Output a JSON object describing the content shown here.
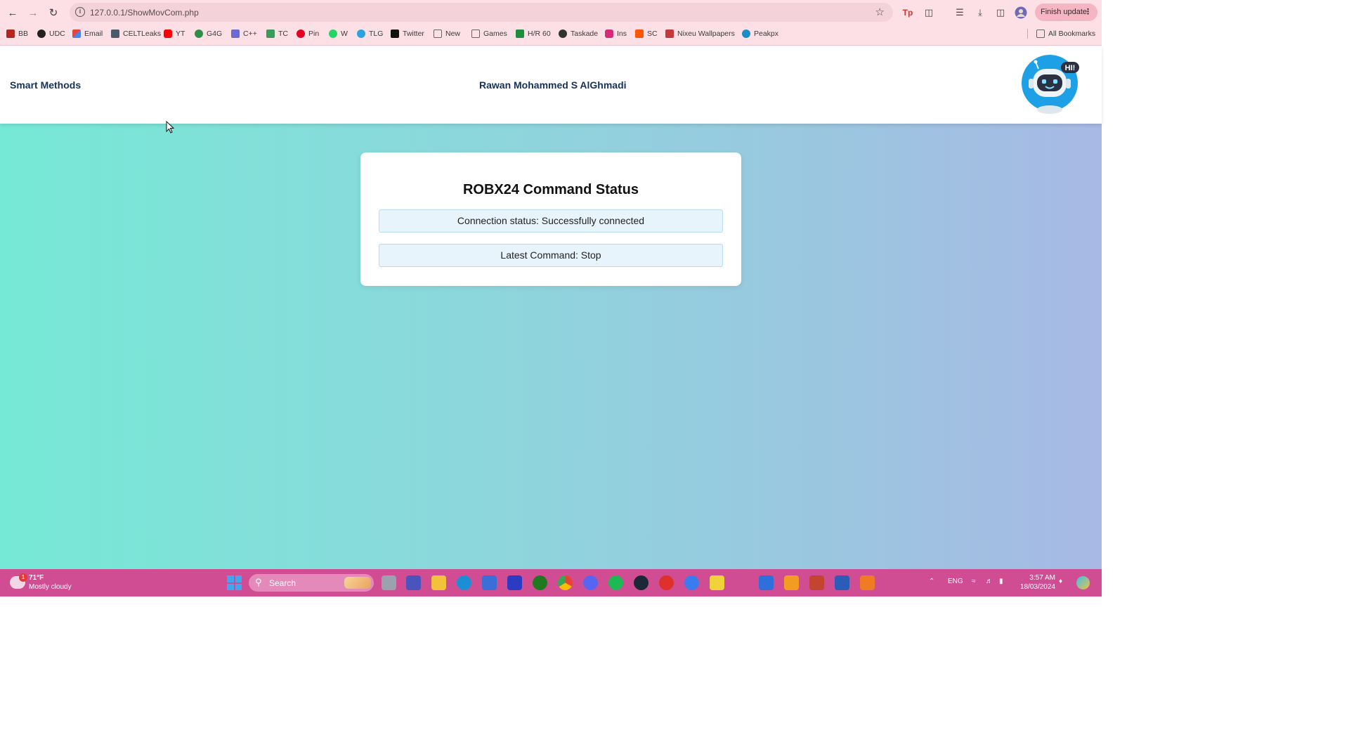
{
  "browser": {
    "url": "127.0.0.1/ShowMovCom.php",
    "finish_update": "Finish update",
    "bookmarks": [
      {
        "label": "BB",
        "color": "#b0281f"
      },
      {
        "label": "UDC",
        "color": "#222222"
      },
      {
        "label": "Email",
        "color": "#4285f4"
      },
      {
        "label": "CELTLeaks",
        "color": "#4a5a6a"
      },
      {
        "label": "YT",
        "color": "#ff0000"
      },
      {
        "label": "G4G",
        "color": "#2f8d46"
      },
      {
        "label": "C++",
        "color": "#6b6bd0"
      },
      {
        "label": "TC",
        "color": "#3a9b5c"
      },
      {
        "label": "Pin",
        "color": "#e60023"
      },
      {
        "label": "W",
        "color": "#25d366"
      },
      {
        "label": "TLG",
        "color": "#2aa3e0"
      },
      {
        "label": "Twitter",
        "color": "#111111"
      },
      {
        "label": "New",
        "color": "#666666"
      },
      {
        "label": "Games",
        "color": "#666666"
      },
      {
        "label": "H/R 60",
        "color": "#1e8e3e"
      },
      {
        "label": "Taskade",
        "color": "#333333"
      },
      {
        "label": "Ins",
        "color": "#d62976"
      },
      {
        "label": "SC",
        "color": "#ff5500"
      },
      {
        "label": "Nixeu Wallpapers",
        "color": "#c43a3a"
      },
      {
        "label": "Peakpx",
        "color": "#1c8cc4"
      }
    ],
    "all_bookmarks": "All Bookmarks"
  },
  "header": {
    "brand": "Smart Methods",
    "author": "Rawan Mohammed S AlGhmadi",
    "bot_bubble": "HI!"
  },
  "card": {
    "title": "ROBX24 Command Status",
    "connection": "Connection status: Successfully connected",
    "command": "Latest Command: Stop"
  },
  "taskbar": {
    "temperature": "71°F",
    "condition": "Mostly cloudy",
    "weather_badge": "1",
    "search": "Search",
    "language": "ENG",
    "time": "3:57 AM",
    "date": "18/03/2024"
  }
}
